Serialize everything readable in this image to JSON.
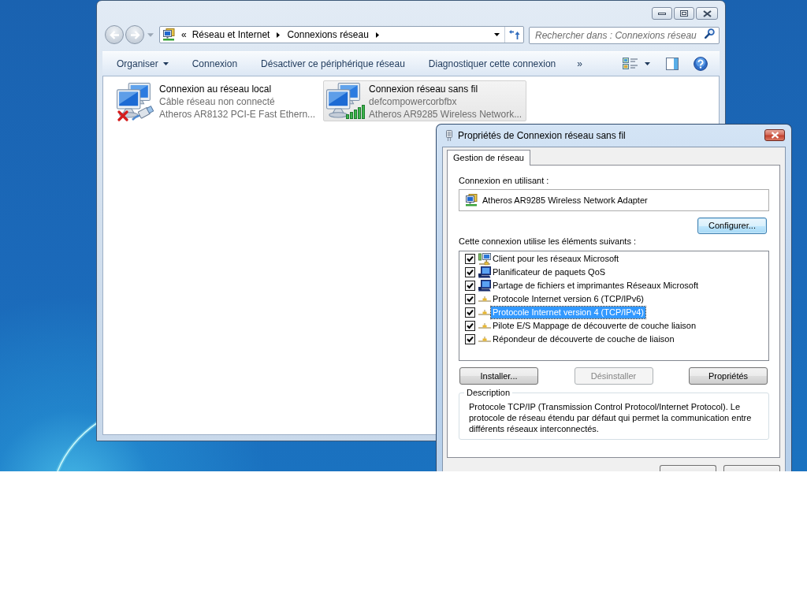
{
  "explorer": {
    "address_bar": {
      "overflow": "«",
      "crumbs": [
        "Réseau et Internet",
        "Connexions réseau"
      ]
    },
    "search": {
      "placeholder": "Rechercher dans : Connexions réseau"
    },
    "toolbar": {
      "items": [
        {
          "label": "Organiser",
          "kind": "menu"
        },
        {
          "label": "Connexion",
          "kind": "command"
        },
        {
          "label": "Désactiver ce périphérique réseau",
          "kind": "command"
        },
        {
          "label": "Diagnostiquer cette connexion",
          "kind": "command"
        }
      ],
      "overflow": "»"
    },
    "connections": [
      {
        "kind": "wired",
        "name": "Connexion au réseau local",
        "status": "Câble réseau non connecté",
        "adapter": "Atheros AR8132 PCI-E Fast Ethern...",
        "disconnected": true,
        "selected": false
      },
      {
        "kind": "wireless",
        "name": "Connexion réseau sans fil",
        "status": "defcompowercorbfbx",
        "adapter": "Atheros AR9285 Wireless Network...",
        "disconnected": false,
        "selected": true
      }
    ]
  },
  "dialog": {
    "title": "Propriétés de Connexion réseau sans fil",
    "tabs": [
      {
        "label": "Gestion de réseau",
        "selected": true
      }
    ],
    "connect_using": {
      "label": "Connexion en utilisant :",
      "adapter": "Atheros AR9285 Wireless Network Adapter",
      "configure_button": {
        "label": "Configurer...",
        "focused": true
      }
    },
    "components": {
      "label": "Cette connexion utilise les éléments suivants :",
      "items": [
        {
          "kind": "client",
          "label": "Client pour les réseaux Microsoft",
          "checked": true,
          "selected": false
        },
        {
          "kind": "service",
          "label": "Planificateur de paquets QoS",
          "checked": true,
          "selected": false
        },
        {
          "kind": "service",
          "label": "Partage de fichiers et imprimantes Réseaux Microsoft",
          "checked": true,
          "selected": false
        },
        {
          "kind": "protocol",
          "label": "Protocole Internet version 6 (TCP/IPv6)",
          "checked": true,
          "selected": false
        },
        {
          "kind": "protocol",
          "label": "Protocole Internet version 4 (TCP/IPv4)",
          "checked": true,
          "selected": true
        },
        {
          "kind": "protocol",
          "label": "Pilote E/S Mappage de découverte de couche liaison",
          "checked": true,
          "selected": false
        },
        {
          "kind": "protocol",
          "label": "Répondeur de découverte de couche de liaison",
          "checked": true,
          "selected": false
        }
      ]
    },
    "buttons": [
      {
        "label": "Installer...",
        "disabled": false
      },
      {
        "label": "Désinstaller",
        "disabled": true
      },
      {
        "label": "Propriétés",
        "disabled": false
      }
    ],
    "description": {
      "title": "Description",
      "text": "Protocole TCP/IP (Transmission Control Protocol/Internet Protocol). Le protocole de réseau étendu par défaut qui permet la communication entre différents réseaux interconnectés."
    }
  }
}
